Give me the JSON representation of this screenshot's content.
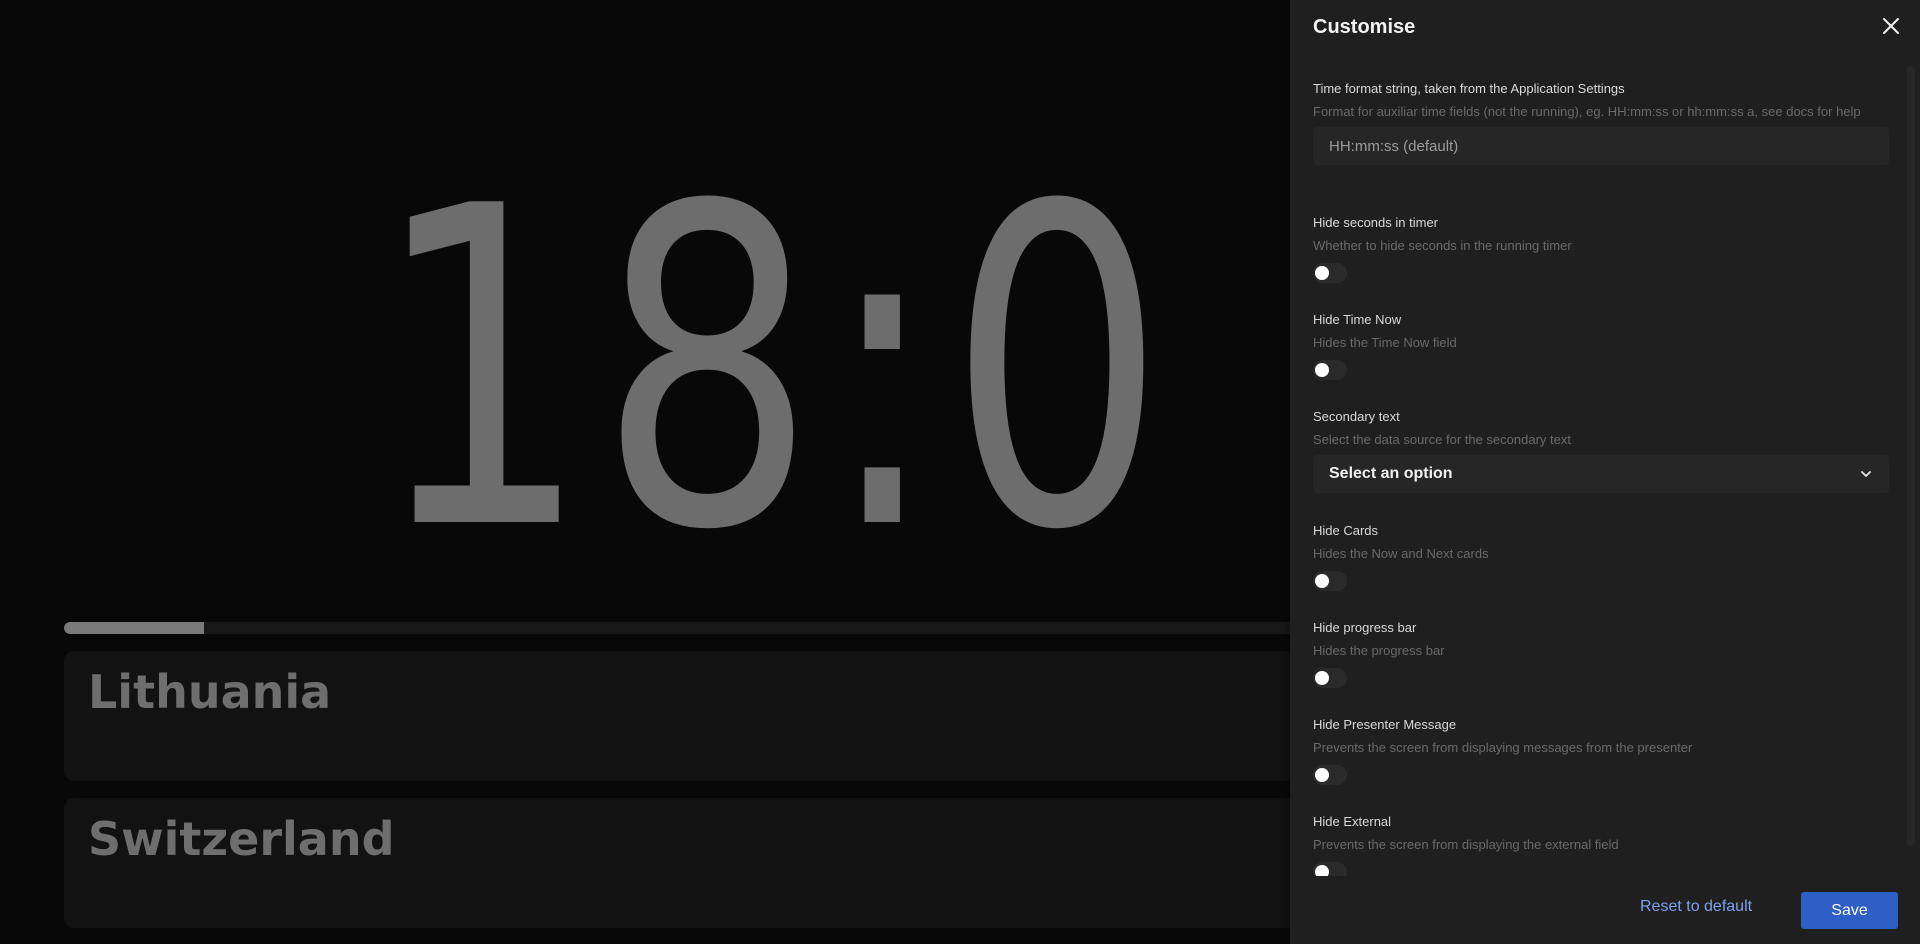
{
  "timer": {
    "visible_text": "18:0"
  },
  "progress": {
    "percent": 9.3
  },
  "cards": [
    {
      "title": "Lithuania"
    },
    {
      "title": "Switzerland"
    }
  ],
  "drawer": {
    "title": "Customise",
    "close_icon": "close-icon",
    "fields": [
      {
        "label": "Time format string, taken from the Application Settings",
        "description": "Format for auxiliar time fields (not the running), eg. HH:mm:ss or hh:mm:ss a, see docs for help",
        "type": "text",
        "value": "",
        "placeholder": "HH:mm:ss (default)"
      },
      {
        "label": "Hide seconds in timer",
        "description": "Whether to hide seconds in the running timer",
        "type": "toggle",
        "checked": false
      },
      {
        "label": "Hide Time Now",
        "description": "Hides the Time Now field",
        "type": "toggle",
        "checked": false
      },
      {
        "label": "Secondary text",
        "description": "Select the data source for the secondary text",
        "type": "select",
        "selected": "Select an option",
        "icon": "chevron-down-icon"
      },
      {
        "label": "Hide Cards",
        "description": "Hides the Now and Next cards",
        "type": "toggle",
        "checked": false
      },
      {
        "label": "Hide progress bar",
        "description": "Hides the progress bar",
        "type": "toggle",
        "checked": false
      },
      {
        "label": "Hide Presenter Message",
        "description": "Prevents the screen from displaying messages from the presenter",
        "type": "toggle",
        "checked": false
      },
      {
        "label": "Hide External",
        "description": "Prevents the screen from displaying the external field",
        "type": "toggle",
        "checked": false
      }
    ],
    "footer": {
      "reset_label": "Reset to default",
      "save_label": "Save"
    }
  },
  "colors": {
    "background": "#080808",
    "drawer_background": "#1f1f1f",
    "accent": "#2d5fc7",
    "link": "#7aa2ee",
    "timer_text": "#6d6d6d"
  }
}
